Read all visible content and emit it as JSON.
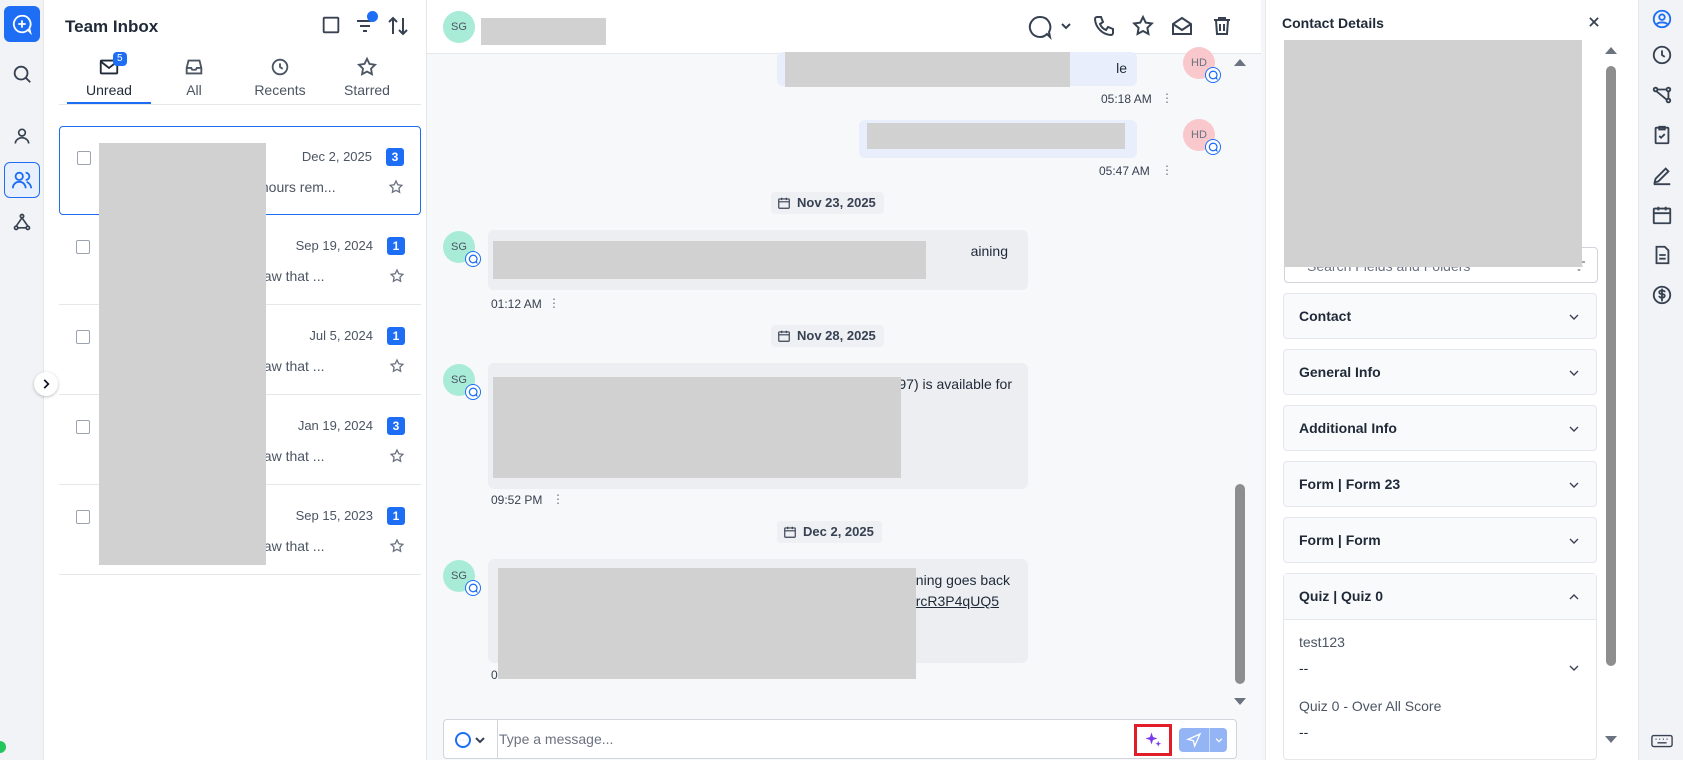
{
  "inbox": {
    "title": "Team Inbox",
    "tabs": [
      {
        "label": "Unread",
        "badge": "5"
      },
      {
        "label": "All"
      },
      {
        "label": "Recents"
      },
      {
        "label": "Starred"
      }
    ],
    "conversations": [
      {
        "date": "Dec 2, 2025",
        "count": "3",
        "preview": "y hours rem..."
      },
      {
        "date": "Sep 19, 2024",
        "count": "1",
        "preview": "I saw that ..."
      },
      {
        "date": "Jul 5, 2024",
        "count": "1",
        "preview": "I saw that ..."
      },
      {
        "date": "Jan 19, 2024",
        "count": "3",
        "preview": "I saw that ..."
      },
      {
        "date": "Sep 15, 2023",
        "count": "1",
        "preview": "I saw that ..."
      }
    ]
  },
  "chat": {
    "header_initials": "SG",
    "messages": [
      {
        "dir": "out",
        "initials": "HD",
        "text_tail": "le",
        "time": "05:18 AM"
      },
      {
        "dir": "out",
        "initials": "HD",
        "text_tail": ".",
        "time": "05:47 AM"
      },
      {
        "date": "Nov 23, 2025"
      },
      {
        "dir": "in",
        "initials": "SG",
        "text_tail": "aining",
        "time": "01:12 AM"
      },
      {
        "date": "Nov 28, 2025"
      },
      {
        "dir": "in",
        "initials": "SG",
        "text_tail": "$297) is available for",
        "time": "09:52 PM"
      },
      {
        "date": "Dec 2, 2025"
      },
      {
        "dir": "in",
        "initials": "SG",
        "text_tail": "Training goes back",
        "link_tail": "om/l/rcR3P4qUQ5",
        "time": "0"
      }
    ],
    "composer": {
      "placeholder": "Type a message..."
    }
  },
  "contact": {
    "title": "Contact Details",
    "search_placeholder": "Search Fields and Folders",
    "sections": [
      {
        "label": "Contact"
      },
      {
        "label": "General Info"
      },
      {
        "label": "Additional Info"
      },
      {
        "label": "Form | Form 23"
      },
      {
        "label": "Form | Form"
      },
      {
        "label": "Quiz | Quiz 0",
        "expanded": true
      }
    ],
    "quiz_fields": [
      {
        "label": "test123",
        "value": "--"
      },
      {
        "label": "Quiz 0 - Over All Score",
        "value": "--"
      }
    ]
  },
  "colors": {
    "accent": "#1d6ef5",
    "highlight": "#e11d2a"
  }
}
